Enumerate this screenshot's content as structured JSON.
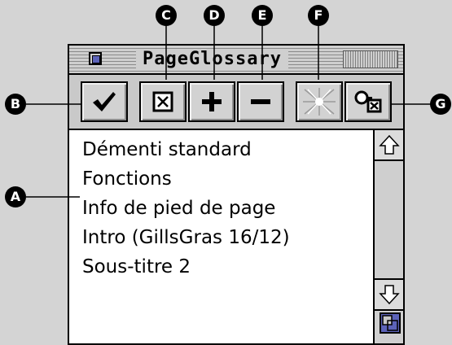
{
  "window": {
    "title": "PageGlossary"
  },
  "toolbar": {
    "buttons": [
      {
        "name": "checkmark-button",
        "icon": "checkmark-icon"
      },
      {
        "name": "x-box-button",
        "icon": "x-box-icon"
      },
      {
        "name": "add-button",
        "icon": "plus-icon"
      },
      {
        "name": "remove-button",
        "icon": "minus-icon"
      },
      {
        "name": "sparkle-button",
        "icon": "sparkle-icon"
      },
      {
        "name": "find-replace-button",
        "icon": "find-icon"
      }
    ]
  },
  "list": {
    "items": [
      "Démenti standard",
      "Fonctions",
      "Info de pied de page",
      "Intro (GillsGras 16/12)",
      "Sous-titre 2"
    ]
  },
  "callouts": {
    "A": "A",
    "B": "B",
    "C": "C",
    "D": "D",
    "E": "E",
    "F": "F",
    "G": "G"
  }
}
